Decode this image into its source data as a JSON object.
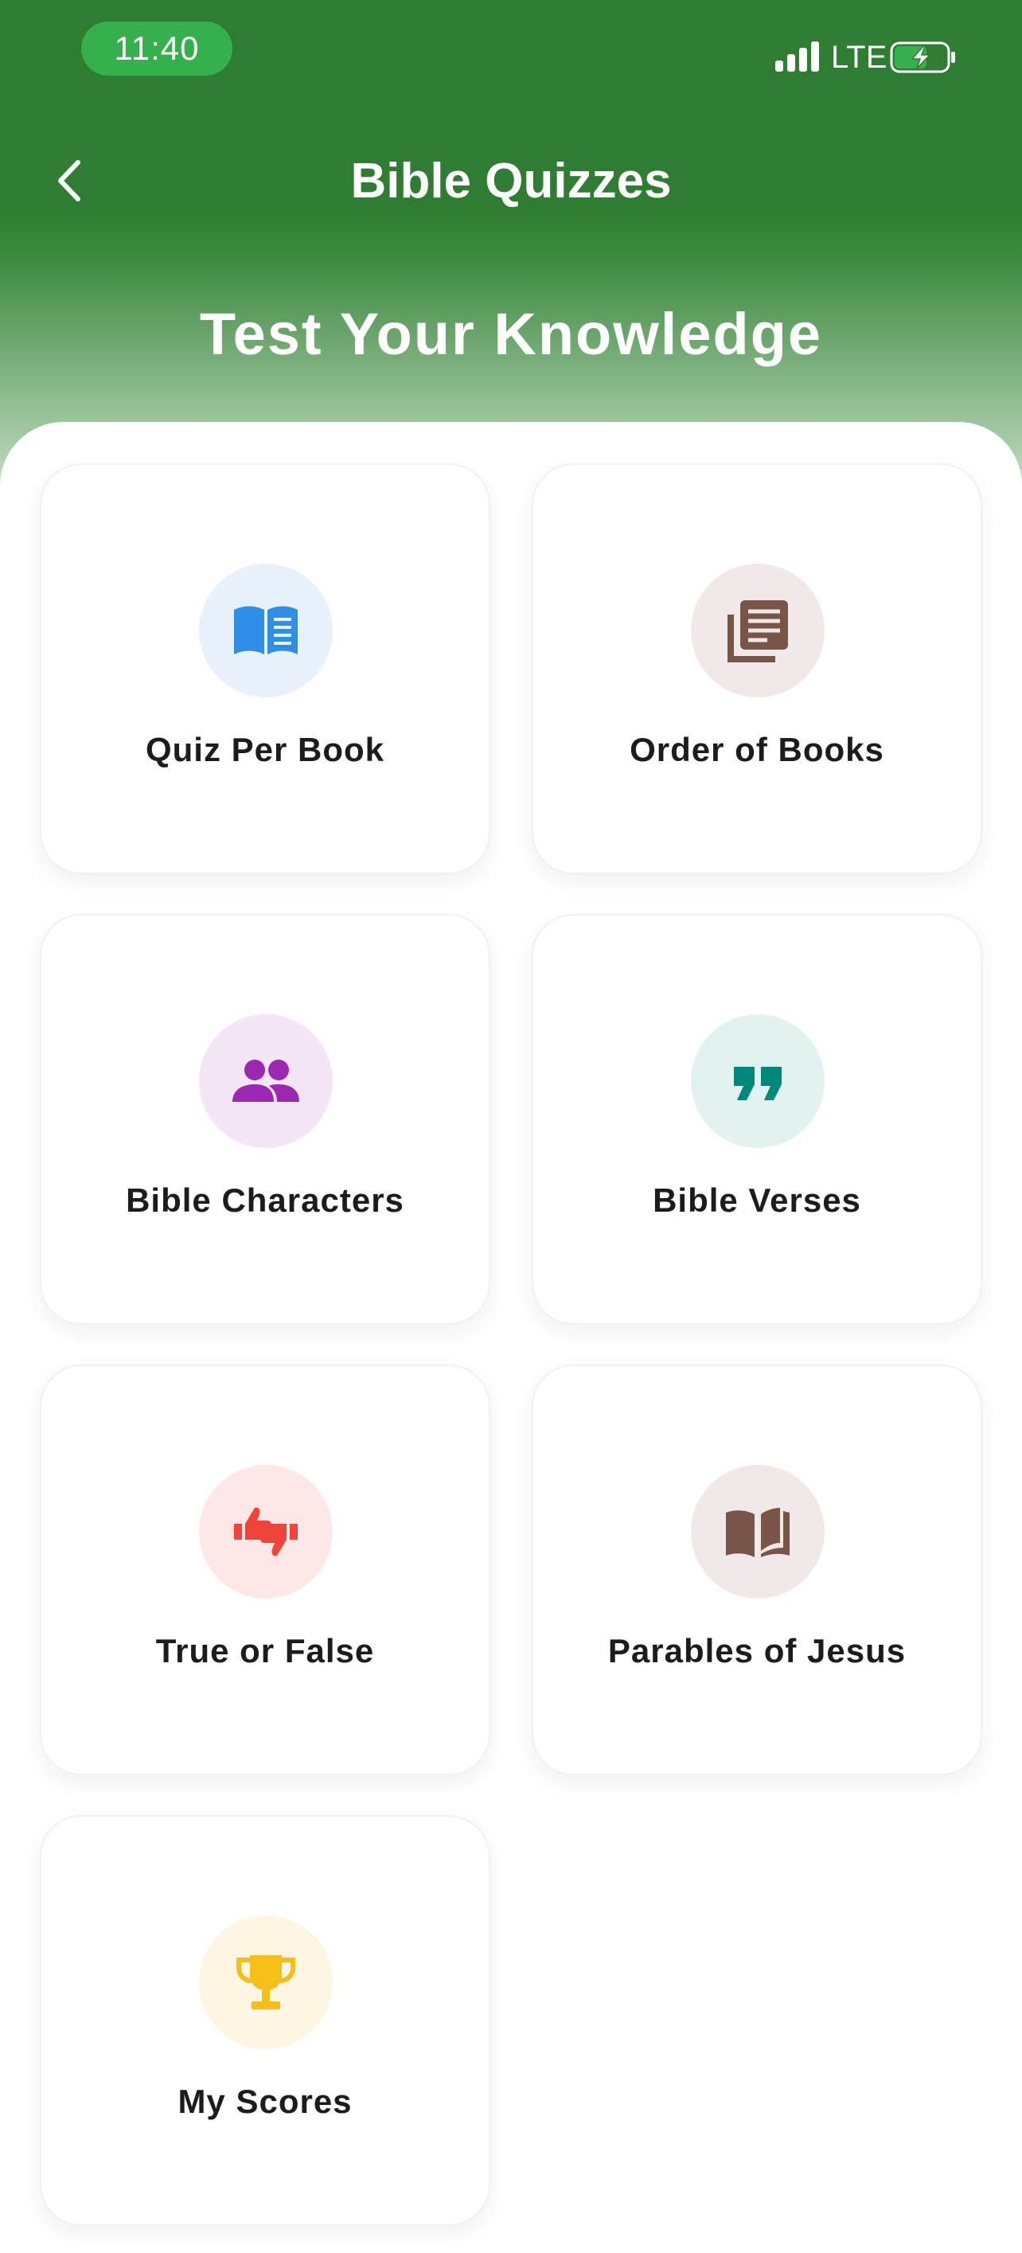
{
  "status_bar": {
    "time": "11:40",
    "network": "LTE"
  },
  "header": {
    "title": "Bible Quizzes",
    "subtitle": "Test Your Knowledge"
  },
  "colors": {
    "header_green": "#2f7d32",
    "time_pill": "#35b04d",
    "card_text": "#1c1c1c"
  },
  "cards": [
    {
      "label": "Quiz Per Book",
      "icon": "open-book-icon",
      "icon_color": "#2f8fe6",
      "circle_color": "#e7f2fd"
    },
    {
      "label": "Order of Books",
      "icon": "library-books-icon",
      "icon_color": "#795548",
      "circle_color": "#f0e9e7"
    },
    {
      "label": "Bible Characters",
      "icon": "people-icon",
      "icon_color": "#9c27b0",
      "circle_color": "#f4e6f6"
    },
    {
      "label": "Bible Verses",
      "icon": "quote-icon",
      "icon_color": "#00897b",
      "circle_color": "#e2f2f0"
    },
    {
      "label": "True or False",
      "icon": "thumbs-up-down-icon",
      "icon_color": "#f0433a",
      "circle_color": "#fde8e7"
    },
    {
      "label": "Parables of Jesus",
      "icon": "menu-book-icon",
      "icon_color": "#795548",
      "circle_color": "#f0e9e7"
    },
    {
      "label": "My Scores",
      "icon": "trophy-icon",
      "icon_color": "#f5bf17",
      "circle_color": "#fdf6e2"
    }
  ]
}
